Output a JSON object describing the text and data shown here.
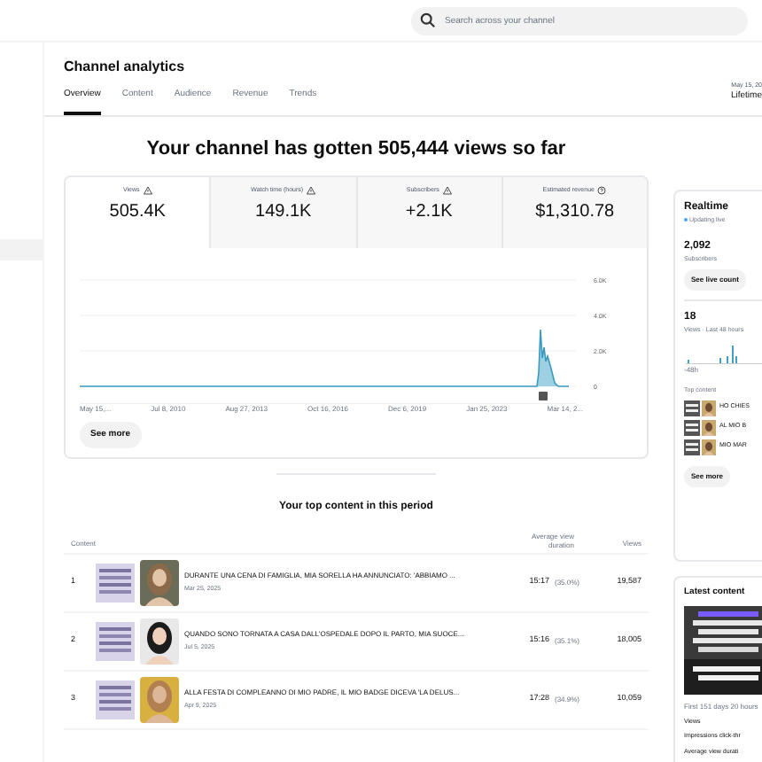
{
  "search": {
    "placeholder": "Search across your channel"
  },
  "page_title": "Channel analytics",
  "tabs": [
    {
      "label": "Overview",
      "selected": true
    },
    {
      "label": "Content",
      "selected": false
    },
    {
      "label": "Audience",
      "selected": false
    },
    {
      "label": "Revenue",
      "selected": false
    },
    {
      "label": "Trends",
      "selected": false
    }
  ],
  "date_range": {
    "dates": "May 15, 20",
    "label": "Lifetime"
  },
  "headline": "Your channel has gotten 505,444 views so far",
  "metrics": [
    {
      "label": "Views",
      "value": "505.4K",
      "selected": true
    },
    {
      "label": "Watch time (hours)",
      "value": "149.1K",
      "selected": false
    },
    {
      "label": "Subscribers",
      "value": "+2.1K",
      "selected": false
    },
    {
      "label": "Estimated revenue",
      "value": "$1,310.78",
      "selected": false
    }
  ],
  "chart": {
    "y_labels": [
      "6.0K",
      "4.0K",
      "2.0K",
      "0"
    ],
    "x_labels": [
      "May 15,...",
      "Jul 8, 2010",
      "Aug 27, 2013",
      "Oct 16, 2016",
      "Dec 6, 2019",
      "Jan 25, 2023",
      "Mar 14, 2..."
    ]
  },
  "see_more": "See more",
  "top_content": {
    "title": "Your top content in this period",
    "columns": [
      "Content",
      "Average view duration",
      "Views"
    ],
    "rows": [
      {
        "rank": "1",
        "title": "DURANTE UNA CENA DI FAMIGLIA, MIA SORELLA HA ANNUNCIATO: 'ABBIAMO ...",
        "date": "Mar 25, 2025",
        "duration": "15:17",
        "percent": "(35.0%)",
        "views": "19,587"
      },
      {
        "rank": "2",
        "title": "QUANDO SONO TORNATA A CASA DALL'OSPEDALE DOPO IL PARTO, MIA SUOCE...",
        "date": "Jul 5, 2025",
        "duration": "15:16",
        "percent": "(35.1%)",
        "views": "18,005"
      },
      {
        "rank": "3",
        "title": "ALLA FESTA DI COMPLEANNO DI MIO PADRE, IL MIO BADGE DICEVA 'LA DELUS...",
        "date": "Apr 9, 2025",
        "duration": "17:28",
        "percent": "(34.9%)",
        "views": "10,059"
      }
    ]
  },
  "realtime": {
    "title": "Realtime",
    "status": "Updating live",
    "subscribers": "2,092",
    "subscribers_label": "Subscribers",
    "live_button": "See live count",
    "views": "18",
    "views_label": "Views · Last 48 hours",
    "axis_label": "-48h",
    "top_content_label": "Top content",
    "top_items": [
      "HO CHIES",
      "AL MIO B",
      "MIO MAR"
    ],
    "see_more": "See more"
  },
  "latest_content": {
    "title": "Latest content",
    "period": "First 151 days 20 hours",
    "stats": [
      "Views",
      "Impressions click-thr",
      "Average view durati"
    ]
  }
}
